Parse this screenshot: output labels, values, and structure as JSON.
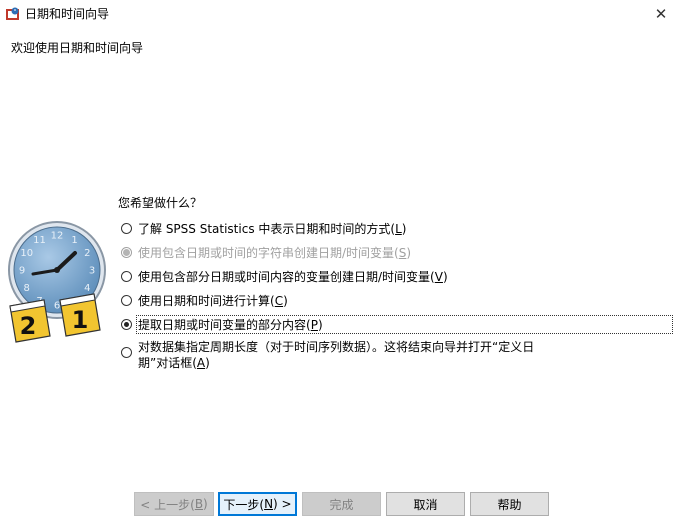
{
  "window": {
    "title": "日期和时间向导",
    "close_glyph": "✕"
  },
  "welcome": "欢迎使用日期和时间向导",
  "question": "您希望做什么？",
  "options": [
    {
      "text": "了解 SPSS Statistics 中表示日期和时间的方式",
      "mnemonic": "L",
      "state": "unchecked"
    },
    {
      "text": "使用包含日期或时间的字符串创建日期/时间变量",
      "mnemonic": "S",
      "state": "disabled"
    },
    {
      "text": "使用包含部分日期或时间内容的变量创建日期/时间变量",
      "mnemonic": "V",
      "state": "unchecked"
    },
    {
      "text": "使用日期和时间进行计算",
      "mnemonic": "C",
      "state": "unchecked"
    },
    {
      "text": "提取日期或时间变量的部分内容",
      "mnemonic": "P",
      "state": "checked"
    },
    {
      "text_line1": "对数据集指定周期长度（对于时间序列数据）。这将结束向导并打开“定义日",
      "text_line2": "期”对话框",
      "mnemonic": "A",
      "state": "unchecked"
    }
  ],
  "clock": {
    "numerals": [
      "12",
      "1",
      "2",
      "3",
      "4",
      "5",
      "6",
      "7",
      "8",
      "9",
      "10",
      "11"
    ],
    "calendar_left": "2",
    "calendar_right": "1"
  },
  "buttons": {
    "back": {
      "label": "< 上一步(",
      "mnemonic": "B",
      "tail": ")"
    },
    "next": {
      "label": "下一步(",
      "mnemonic": "N",
      "tail": ") >"
    },
    "finish": {
      "label": "完成"
    },
    "cancel": {
      "label": "取消"
    },
    "help": {
      "label": "帮助"
    }
  },
  "colors": {
    "accent": "#0078d7",
    "clock_face": "#7ba8cf",
    "calendar": "#f2c530"
  }
}
